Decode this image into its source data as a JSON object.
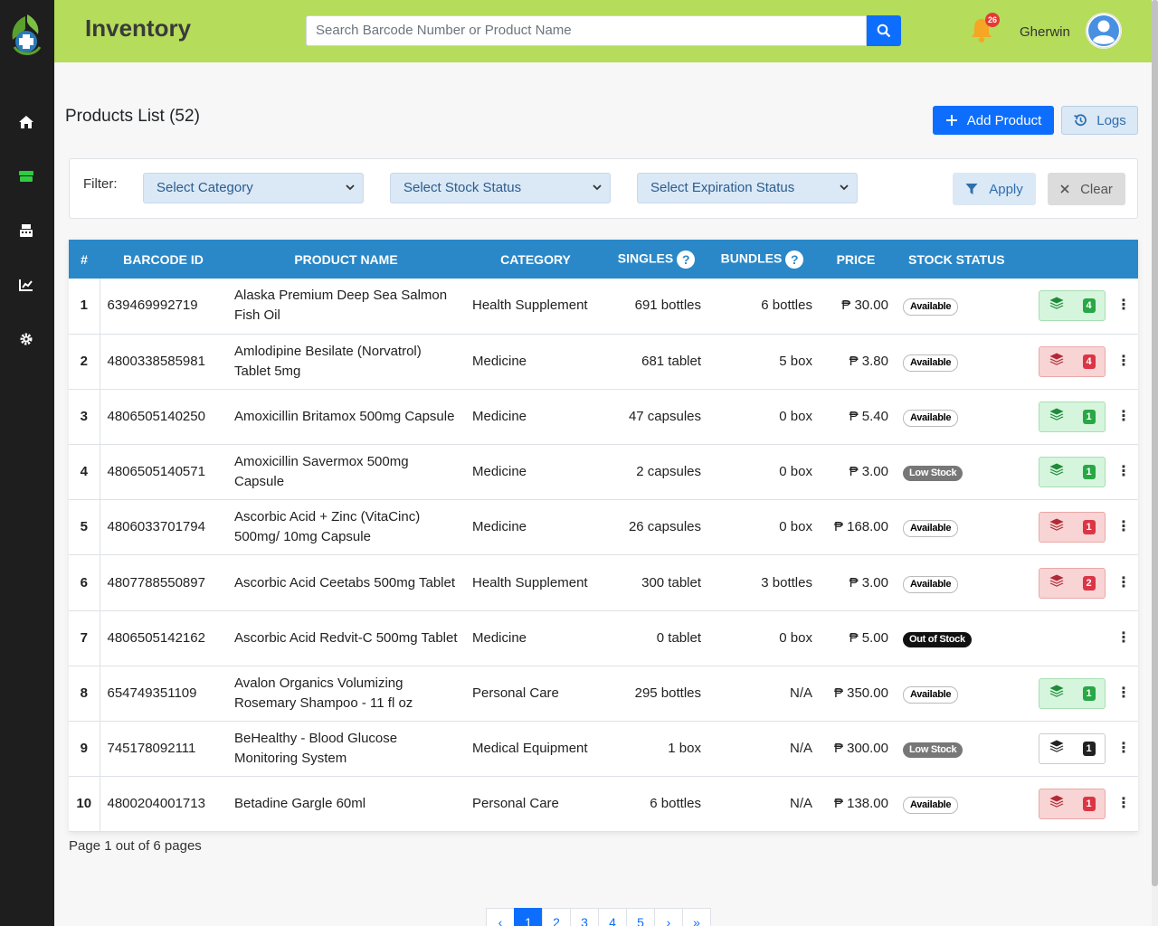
{
  "header": {
    "title": "Inventory",
    "search_placeholder": "Search Barcode Number or Product Name",
    "notification_count": "26",
    "username": "Gherwin"
  },
  "sidebar": {
    "items": [
      {
        "name": "home-icon"
      },
      {
        "name": "inventory-icon"
      },
      {
        "name": "cash-register-icon"
      },
      {
        "name": "chart-line-icon"
      },
      {
        "name": "gear-icon"
      }
    ]
  },
  "page": {
    "title": "Products List (52)",
    "add_label": "Add Product",
    "logs_label": "Logs"
  },
  "filter": {
    "label": "Filter:",
    "category": "Select Category",
    "stock_status": "Select Stock Status",
    "expiration_status": "Select Expiration Status",
    "apply_label": "Apply",
    "clear_label": "Clear"
  },
  "table": {
    "headers": {
      "num": "#",
      "barcode": "BARCODE ID",
      "product": "PRODUCT NAME",
      "category": "CATEGORY",
      "singles": "SINGLES",
      "bundles": "BUNDLES",
      "price": "PRICE",
      "stock": "STOCK STATUS",
      "help": "?"
    },
    "rows": [
      {
        "num": "1",
        "barcode": "639469992719",
        "name": "Alaska Premium Deep Sea Salmon Fish Oil",
        "category": "Health Supplement",
        "singles": "691 bottles",
        "bundles": "6 bottles",
        "price": "₱ 30.00",
        "status": "Available",
        "batch_color": "green",
        "batch_count": "4"
      },
      {
        "num": "2",
        "barcode": "4800338585981",
        "name": "Amlodipine Besilate (Norvatrol) Tablet 5mg",
        "category": "Medicine",
        "singles": "681 tablet",
        "bundles": "5 box",
        "price": "₱ 3.80",
        "status": "Available",
        "batch_color": "red",
        "batch_count": "4"
      },
      {
        "num": "3",
        "barcode": "4806505140250",
        "name": "Amoxicillin Britamox 500mg Capsule",
        "category": "Medicine",
        "singles": "47 capsules",
        "bundles": "0 box",
        "price": "₱ 5.40",
        "status": "Available",
        "batch_color": "green",
        "batch_count": "1"
      },
      {
        "num": "4",
        "barcode": "4806505140571",
        "name": "Amoxicillin Savermox 500mg Capsule",
        "category": "Medicine",
        "singles": "2 capsules",
        "bundles": "0 box",
        "price": "₱ 3.00",
        "status": "Low Stock",
        "batch_color": "green",
        "batch_count": "1"
      },
      {
        "num": "5",
        "barcode": "4806033701794",
        "name": "Ascorbic Acid + Zinc (VitaCinc) 500mg/ 10mg Capsule",
        "category": "Medicine",
        "singles": "26 capsules",
        "bundles": "0 box",
        "price": "₱ 168.00",
        "status": "Available",
        "batch_color": "red",
        "batch_count": "1"
      },
      {
        "num": "6",
        "barcode": "4807788550897",
        "name": "Ascorbic Acid Ceetabs 500mg Tablet",
        "category": "Health Supplement",
        "singles": "300 tablet",
        "bundles": "3 bottles",
        "price": "₱ 3.00",
        "status": "Available",
        "batch_color": "red",
        "batch_count": "2"
      },
      {
        "num": "7",
        "barcode": "4806505142162",
        "name": "Ascorbic Acid Redvit-C 500mg Tablet",
        "category": "Medicine",
        "singles": "0 tablet",
        "bundles": "0 box",
        "price": "₱ 5.00",
        "status": "Out of Stock",
        "batch_color": "none",
        "batch_count": ""
      },
      {
        "num": "8",
        "barcode": "654749351109",
        "name": "Avalon Organics Volumizing Rosemary Shampoo - 11 fl oz",
        "category": "Personal Care",
        "singles": "295 bottles",
        "bundles": "N/A",
        "price": "₱ 350.00",
        "status": "Available",
        "batch_color": "green",
        "batch_count": "1"
      },
      {
        "num": "9",
        "barcode": "745178092111",
        "name": "BeHealthy - Blood Glucose Monitoring System",
        "category": "Medical Equipment",
        "singles": "1 box",
        "bundles": "N/A",
        "price": "₱ 300.00",
        "status": "Low Stock",
        "batch_color": "white",
        "batch_count": "1"
      },
      {
        "num": "10",
        "barcode": "4800204001713",
        "name": "Betadine Gargle 60ml",
        "category": "Personal Care",
        "singles": "6 bottles",
        "bundles": "N/A",
        "price": "₱ 138.00",
        "status": "Available",
        "batch_color": "red",
        "batch_count": "1"
      }
    ]
  },
  "footer": {
    "page_info": "Page 1 out of 6 pages",
    "pages": [
      "‹",
      "1",
      "2",
      "3",
      "4",
      "5",
      "›",
      "»"
    ],
    "active_page": "1"
  },
  "colors": {
    "header_bg": "#b5dc5b",
    "table_header": "#2a88c8",
    "primary": "#0d6efd",
    "sidebar": "#1e1e1e"
  }
}
